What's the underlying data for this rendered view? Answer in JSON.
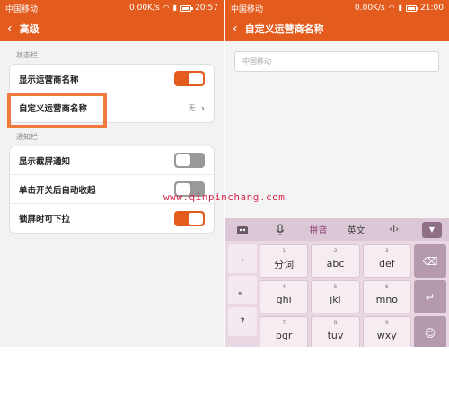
{
  "left": {
    "status": {
      "carrier": "中国移动",
      "speed": "0.00K/s",
      "time": "20:57"
    },
    "title": "高级",
    "sections": [
      {
        "header": "状态栏"
      },
      {
        "header": "通知栏"
      }
    ],
    "status_rows": [
      {
        "label": "显示运营商名称",
        "toggle": "on"
      },
      {
        "label": "自定义运营商名称",
        "value": "无"
      }
    ],
    "notify_rows": [
      {
        "label": "显示截屏通知",
        "toggle": "off"
      },
      {
        "label": "单击开关后自动收起",
        "toggle": "off"
      },
      {
        "label": "锁屏时可下拉",
        "toggle": "on"
      }
    ]
  },
  "right": {
    "status": {
      "carrier": "中国移动",
      "speed": "0.00K/s",
      "time": "21:00"
    },
    "title": "自定义运营商名称",
    "input_placeholder": "中国移动",
    "ime": {
      "toolbar": {
        "voice_icon": "mic-icon",
        "pinyin": "拼音",
        "english": "英文",
        "cursor": "‹I›"
      },
      "side_keys": [
        ",",
        "。",
        "?",
        "!"
      ],
      "keys": [
        {
          "num": "1",
          "main": "分词"
        },
        {
          "num": "2",
          "main": "abc"
        },
        {
          "num": "3",
          "main": "def"
        },
        {
          "num": "4",
          "main": "ghi"
        },
        {
          "num": "5",
          "main": "jkl"
        },
        {
          "num": "6",
          "main": "mno"
        },
        {
          "num": "7",
          "main": "pqr"
        },
        {
          "num": "8",
          "main": "tuv"
        },
        {
          "num": "9",
          "main": "wxy"
        }
      ]
    }
  },
  "watermark": "www.qinpinchang.com",
  "colors": {
    "accent": "#e35b1d",
    "highlight": "#f07a3e",
    "watermark": "#d4264c"
  }
}
